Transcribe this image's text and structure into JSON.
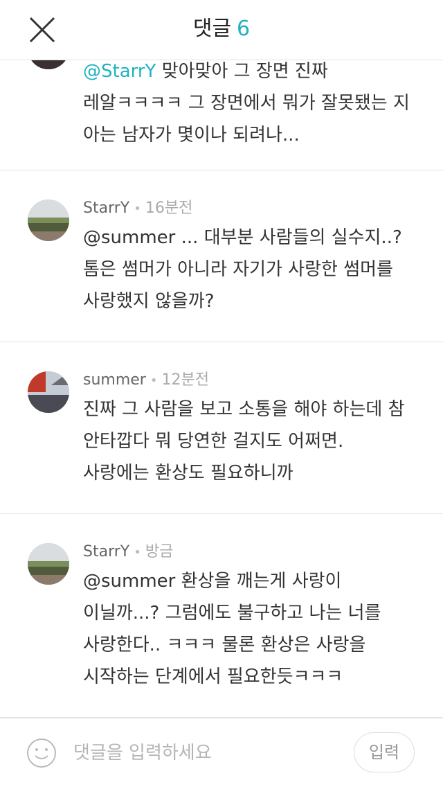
{
  "header": {
    "title": "댓글",
    "count": "6"
  },
  "comments": [
    {
      "mention": "@StarrY",
      "text": " 맞아맞아 그 장면 진짜 레알ㅋㅋㅋㅋ 그 장면에서 뭐가 잘못됐는 지 아는 남자가 몇이나 되려나..."
    },
    {
      "author": "StarrY",
      "time": "16분전",
      "mention": "@summer",
      "text": "  ... 대부분 사람들의 실수지..? 톰은 썸머가 아니라 자기가 사랑한 썸머를 사랑했지 않을까?"
    },
    {
      "author": "summer",
      "time": "12분전",
      "text": "진짜 그 사람을 보고 소통을 해야 하는데 참 안타깝다 뭐 당연한 걸지도 어쩌면. 사랑에는 환상도 필요하니까"
    },
    {
      "author": "StarrY",
      "time": "방금",
      "mention": "@summer",
      "text": " 환상을 깨는게 사랑이 이닐까...? 그럼에도 불구하고 나는 너를 사랑한다.. ㅋㅋㅋ 물론 환상은 사랑을 시작하는 단계에서 필요한듯ㅋㅋㅋ"
    }
  ],
  "input_bar": {
    "placeholder": "댓글을 입력하세요",
    "submit_label": "입력",
    "emoji_icon": "smiley-icon"
  },
  "colors": {
    "accent": "#1fb3c2",
    "text": "#333333",
    "meta": "#aaaaaa",
    "divider": "#e6e6e6"
  }
}
